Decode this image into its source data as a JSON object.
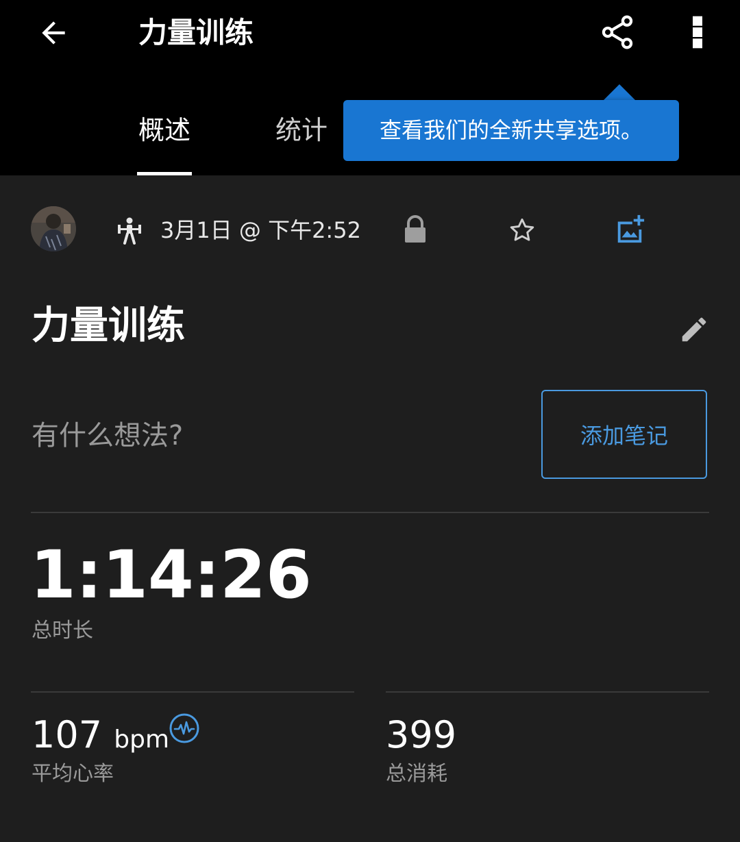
{
  "header": {
    "title": "力量训练",
    "tabs": [
      {
        "label": "概述",
        "active": true
      },
      {
        "label": "统计",
        "active": false
      }
    ]
  },
  "tooltip": {
    "text": "查看我们的全新共享选项。"
  },
  "activity": {
    "datetime": "3月1日 @ 下午2:52",
    "type_icon": "strength-training-icon",
    "name": "力量训练"
  },
  "notes": {
    "prompt": "有什么想法?",
    "add_button": "添加笔记"
  },
  "duration": {
    "value": "1:14:26",
    "label": "总时长"
  },
  "heart_rate": {
    "value": "107",
    "unit": "bpm",
    "label": "平均心率"
  },
  "calories": {
    "value": "399",
    "label": "总消耗"
  },
  "colors": {
    "accent": "#4a9ae0",
    "tooltip_bg": "#1976d2",
    "background": "#1e1e1e",
    "header_bg": "#000000"
  }
}
